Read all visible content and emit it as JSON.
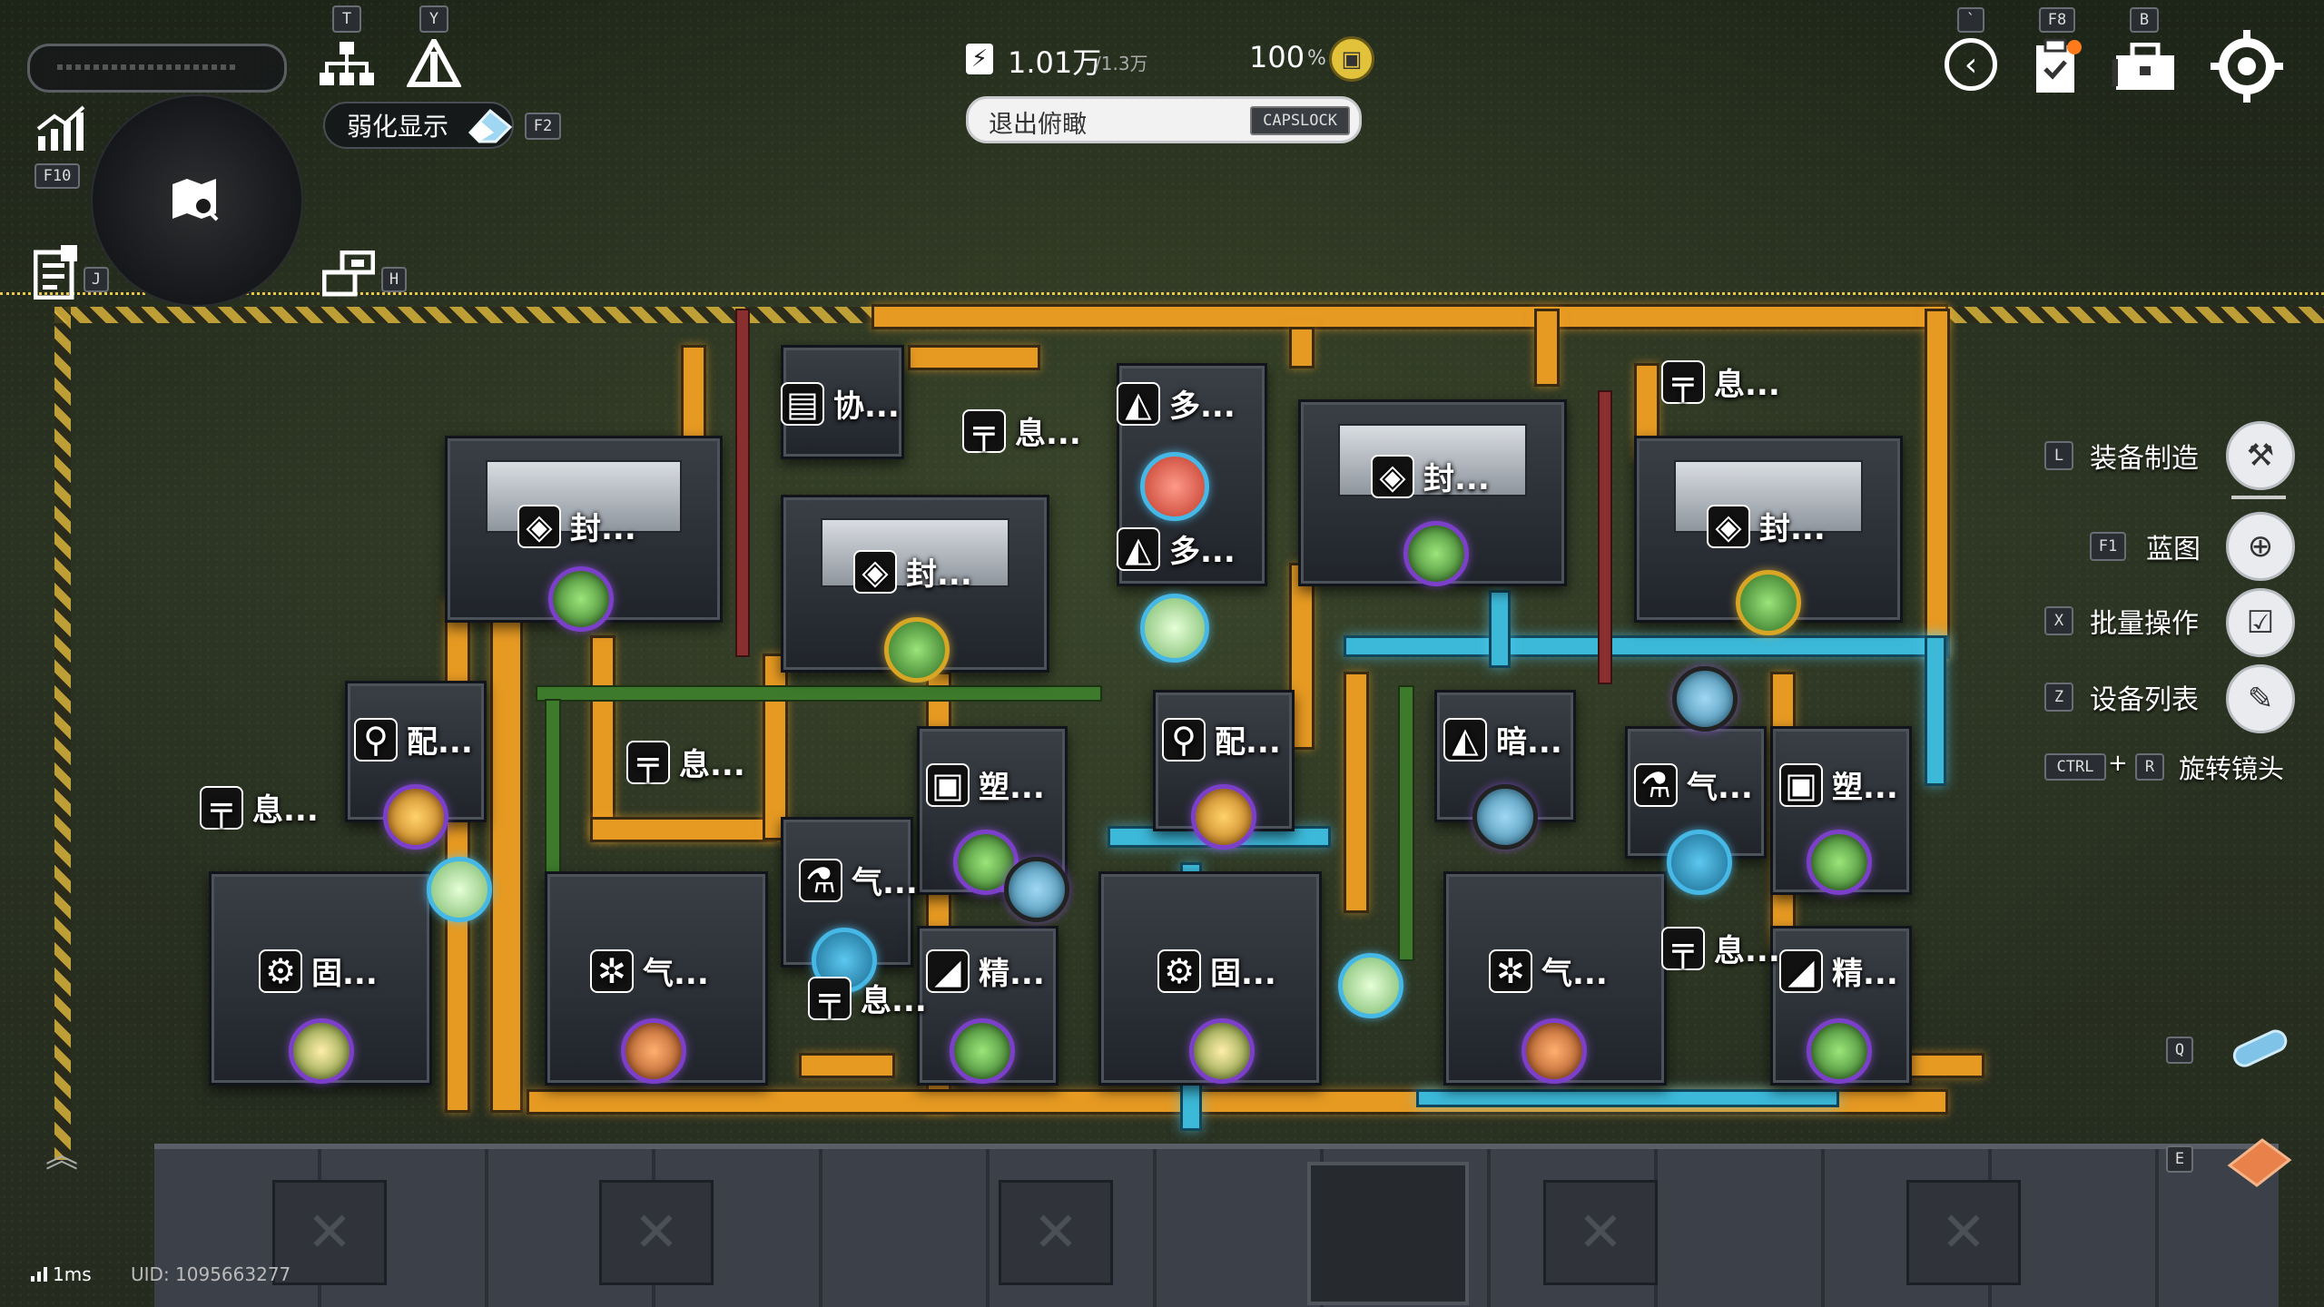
{
  "hud": {
    "power_value": "1.01万",
    "power_capacity": "/1.3万",
    "efficiency_value": "100",
    "efficiency_unit": "%",
    "exit_overview_label": "退出俯瞰",
    "exit_overview_key": "CAPSLOCK",
    "weaken_display_label": "弱化显示",
    "weaken_display_key": "F2",
    "key_t": "T",
    "key_y": "Y",
    "key_f10": "F10",
    "key_j": "J",
    "key_h": "H",
    "key_backtick": "`",
    "key_f8": "F8",
    "key_b": "B",
    "key_q": "Q",
    "key_e": "E",
    "latency": "1ms",
    "uid": "UID: 1095663277"
  },
  "side_menu": [
    {
      "key": "L",
      "label": "装备制造",
      "icon": "equipment-craft-icon"
    },
    {
      "key": "F1",
      "label": "蓝图",
      "icon": "blueprint-icon"
    },
    {
      "key": "X",
      "label": "批量操作",
      "icon": "batch-operation-icon"
    },
    {
      "key": "Z",
      "label": "设备列表",
      "icon": "device-list-icon"
    }
  ],
  "rotate_hint": {
    "key1": "CTRL",
    "plus": "+",
    "key2": "R",
    "label": "旋转镜头"
  },
  "machines": [
    {
      "label": "协...",
      "icon": "▤"
    },
    {
      "label": "息...",
      "icon": "╤"
    },
    {
      "label": "多...",
      "icon": "◭"
    },
    {
      "label": "多...",
      "icon": "◭"
    },
    {
      "label": "息...",
      "icon": "╤"
    },
    {
      "label": "封...",
      "icon": "◈"
    },
    {
      "label": "封...",
      "icon": "◈"
    },
    {
      "label": "封...",
      "icon": "◈"
    },
    {
      "label": "封...",
      "icon": "◈"
    },
    {
      "label": "配...",
      "icon": "⚲"
    },
    {
      "label": "息...",
      "icon": "╤"
    },
    {
      "label": "息...",
      "icon": "╤"
    },
    {
      "label": "配...",
      "icon": "⚲"
    },
    {
      "label": "塑...",
      "icon": "▣"
    },
    {
      "label": "暗...",
      "icon": "◭"
    },
    {
      "label": "气...",
      "icon": "⚗"
    },
    {
      "label": "塑...",
      "icon": "▣"
    },
    {
      "label": "气...",
      "icon": "⚗"
    },
    {
      "label": "固...",
      "icon": "⚙"
    },
    {
      "label": "气...",
      "icon": "✲"
    },
    {
      "label": "息...",
      "icon": "╤"
    },
    {
      "label": "精...",
      "icon": "◢"
    },
    {
      "label": "固...",
      "icon": "⚙"
    },
    {
      "label": "气...",
      "icon": "✲"
    },
    {
      "label": "息...",
      "icon": "╤"
    },
    {
      "label": "精...",
      "icon": "◢"
    }
  ],
  "colors": {
    "belt": "#e69a22",
    "pipe": "#3cb8d8",
    "orb_purple": "#7c3fc9",
    "orb_gold": "#d8a624",
    "hazard": "#d8b23a"
  }
}
